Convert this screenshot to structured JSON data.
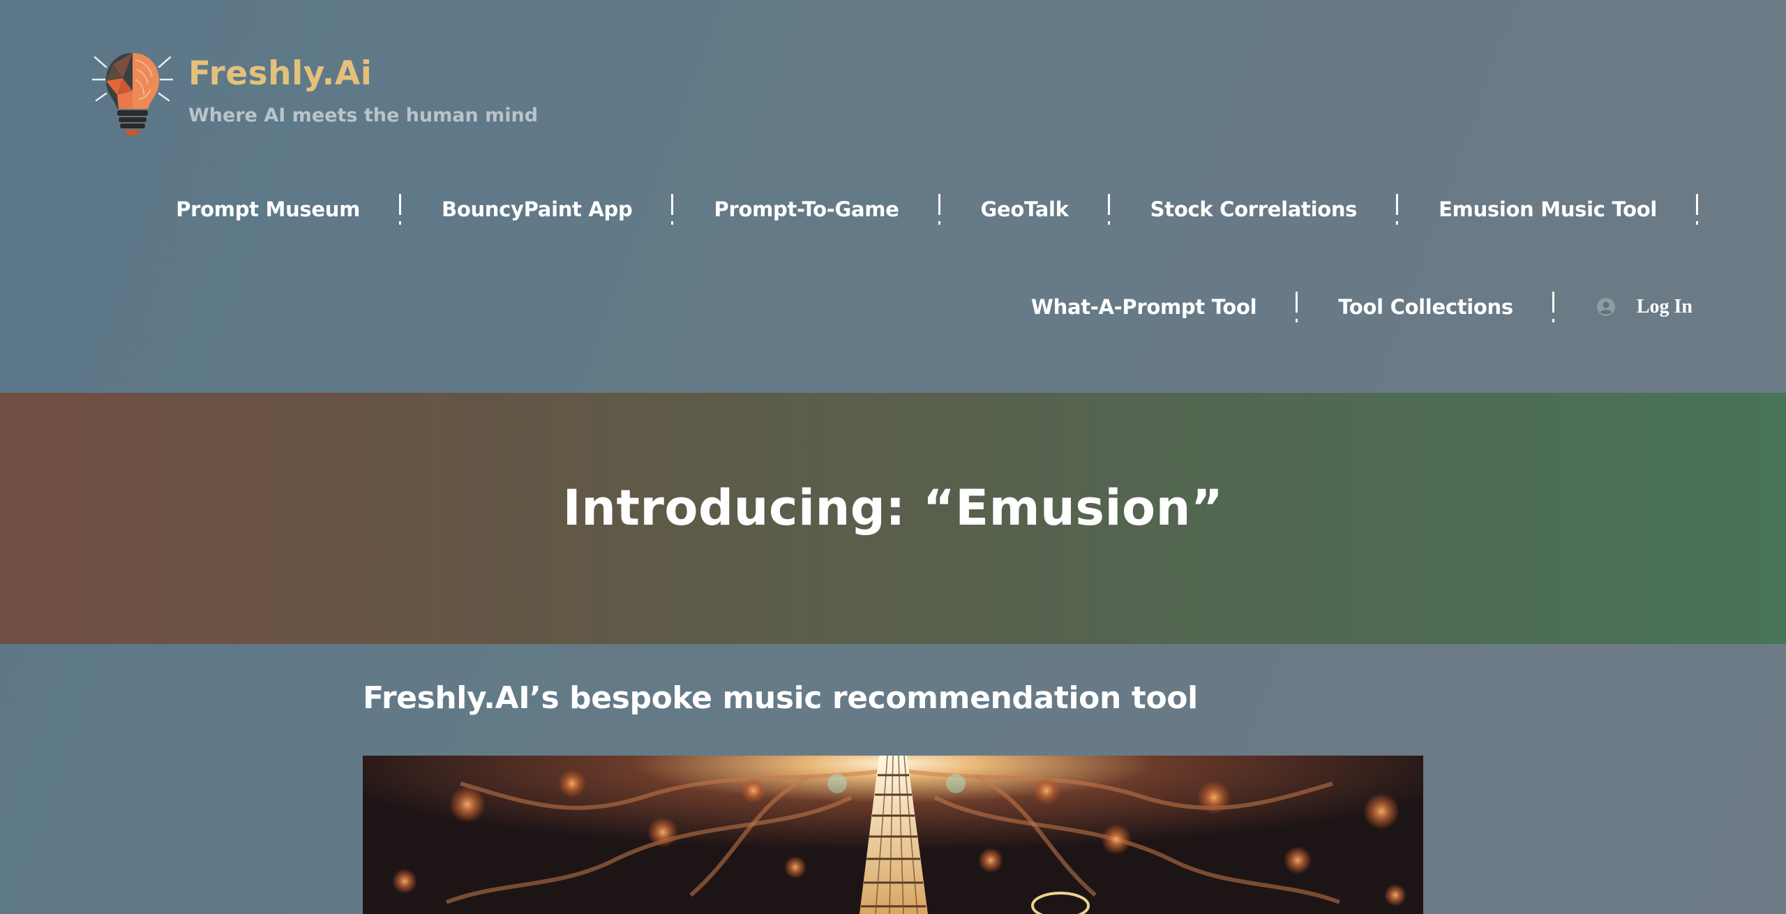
{
  "brand": {
    "title": "Freshly.Ai",
    "tagline": "Where AI meets the human mind",
    "logo_icon": "lightbulb-brain-icon"
  },
  "nav": {
    "row1": [
      "Prompt Museum",
      "BouncyPaint App",
      "Prompt-To-Game",
      "GeoTalk",
      "Stock Correlations",
      "Emusion Music Tool"
    ],
    "row2": [
      "What-A-Prompt Tool",
      "Tool Collections"
    ],
    "login_label": "Log In",
    "login_icon": "user-circle-icon"
  },
  "hero": {
    "title": "Introducing: “Emusion”"
  },
  "content": {
    "heading": "Freshly.AI’s bespoke music recommendation tool",
    "image_subject": "guitar-neck-illustration"
  },
  "colors": {
    "brand_title": "#e4c17b",
    "tagline": "#b8c4cb",
    "hero_gradient_start": "#714f42",
    "hero_gradient_end": "#487458",
    "page_background": "#637a88"
  }
}
